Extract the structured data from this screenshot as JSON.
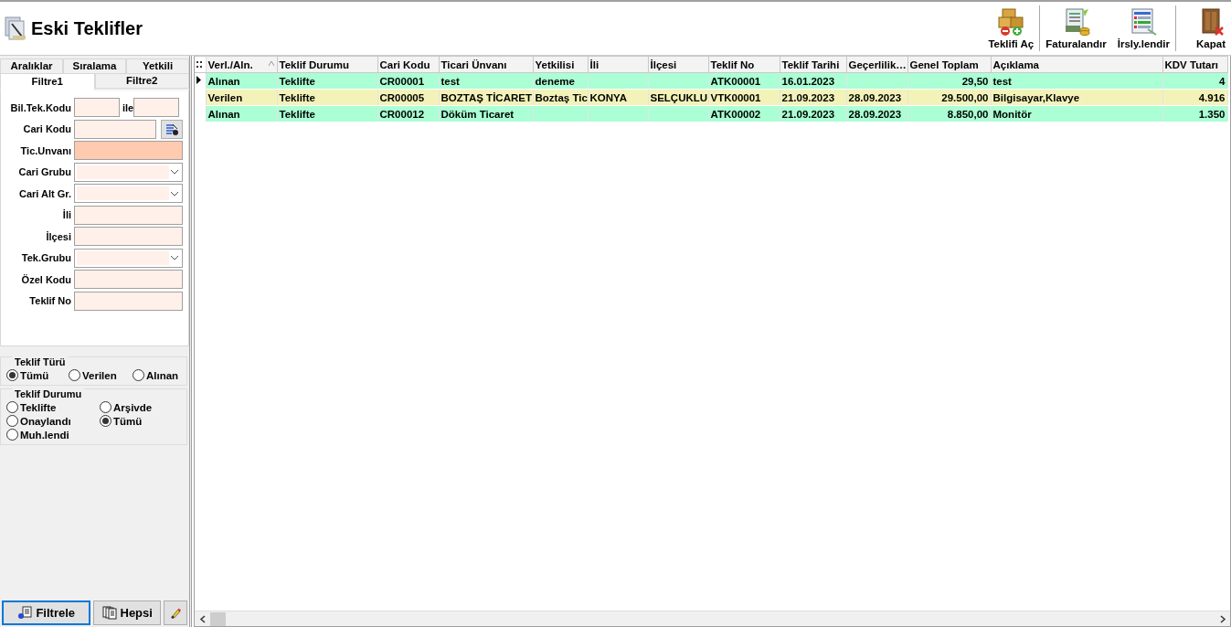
{
  "window": {
    "title": "Eski Teklifler"
  },
  "toolbar": [
    {
      "label": "Teklifi Aç"
    },
    {
      "label": "Faturalandır"
    },
    {
      "label": "İrsly.lendir"
    },
    {
      "label": "Kapat"
    }
  ],
  "filter_tabs": [
    {
      "label": "Aralıklar",
      "selected": false
    },
    {
      "label": "Sıralama",
      "selected": false
    },
    {
      "label": "Yetkili",
      "selected": false
    },
    {
      "label": "Filtre1",
      "selected": true
    },
    {
      "label": "Filtre2",
      "selected": false
    }
  ],
  "filter_fields": [
    {
      "label": "Bil.Tek.Kodu",
      "kind": "range",
      "joiner": "ile",
      "highlighted": false
    },
    {
      "label": "Cari Kodu",
      "kind": "lookup",
      "highlighted": false
    },
    {
      "label": "Tic.Unvanı",
      "kind": "text",
      "highlighted": true
    },
    {
      "label": "Cari Grubu",
      "kind": "combo",
      "highlighted": false
    },
    {
      "label": "Cari Alt Gr.",
      "kind": "combo",
      "highlighted": false
    },
    {
      "label": "İli",
      "kind": "text",
      "highlighted": false
    },
    {
      "label": "İlçesi",
      "kind": "text",
      "highlighted": false
    },
    {
      "label": "Tek.Grubu",
      "kind": "combo",
      "highlighted": false
    },
    {
      "label": "Özel Kodu",
      "kind": "text",
      "highlighted": false
    },
    {
      "label": "Teklif No",
      "kind": "text",
      "highlighted": false
    }
  ],
  "radio_groups": [
    {
      "title": "Teklif Türü",
      "options": [
        {
          "label": "Tümü",
          "selected": true
        },
        {
          "label": "Verilen",
          "selected": false
        },
        {
          "label": "Alınan",
          "selected": false
        }
      ]
    },
    {
      "title": "Teklif Durumu",
      "options": [
        {
          "label": "Teklifte",
          "selected": false
        },
        {
          "label": "Arşivde",
          "selected": false
        },
        {
          "label": "Onaylandı",
          "selected": false
        },
        {
          "label": "Tümü",
          "selected": true
        },
        {
          "label": "Muh.lendi",
          "selected": false
        }
      ]
    }
  ],
  "bottom_buttons": [
    {
      "label": "Filtrele",
      "focused": true
    },
    {
      "label": "Hepsi",
      "focused": false
    },
    {
      "focused": false
    }
  ],
  "table": {
    "columns": [
      {
        "label": "Verl./Aln.",
        "sorted": true,
        "numeric": false
      },
      {
        "label": "Teklif Durumu",
        "sorted": false,
        "numeric": false
      },
      {
        "label": "Cari Kodu",
        "sorted": false,
        "numeric": false
      },
      {
        "label": "Ticari Ünvanı",
        "sorted": false,
        "numeric": false
      },
      {
        "label": "Yetkilisi",
        "sorted": false,
        "numeric": false
      },
      {
        "label": "İli",
        "sorted": false,
        "numeric": false
      },
      {
        "label": "İlçesi",
        "sorted": false,
        "numeric": false
      },
      {
        "label": "Teklif No",
        "sorted": false,
        "numeric": false
      },
      {
        "label": "Teklif Tarihi",
        "sorted": false,
        "numeric": false
      },
      {
        "label": "Geçerlilik…",
        "sorted": false,
        "numeric": false
      },
      {
        "label": "Genel Toplam",
        "sorted": false,
        "numeric": true
      },
      {
        "label": "Açıklama",
        "sorted": false,
        "numeric": false
      },
      {
        "label": "KDV Tutarı",
        "sorted": false,
        "numeric": true
      }
    ],
    "rows": [
      {
        "current": true,
        "color": "#aaffd4",
        "cells": [
          "Alınan",
          "Teklifte",
          "CR00001",
          "test",
          "deneme",
          "",
          "",
          "ATK00001",
          "16.01.2023",
          "",
          "29,50",
          "test",
          "4"
        ]
      },
      {
        "current": false,
        "color": "#f3f3b9",
        "cells": [
          "Verilen",
          "Teklifte",
          "CR00005",
          "BOZTAŞ TİCARET",
          "Boztaş Tic",
          "KONYA",
          "SELÇUKLU",
          "VTK00001",
          "21.09.2023",
          "28.09.2023",
          "29.500,00",
          "Bilgisayar,Klavye",
          "4.916"
        ]
      },
      {
        "current": false,
        "color": "#aaffd4",
        "cells": [
          "Alınan",
          "Teklifte",
          "CR00012",
          "Döküm Ticaret",
          "",
          "",
          "",
          "ATK00002",
          "21.09.2023",
          "28.09.2023",
          "8.850,00",
          "Monitör",
          "1.350"
        ]
      }
    ]
  }
}
